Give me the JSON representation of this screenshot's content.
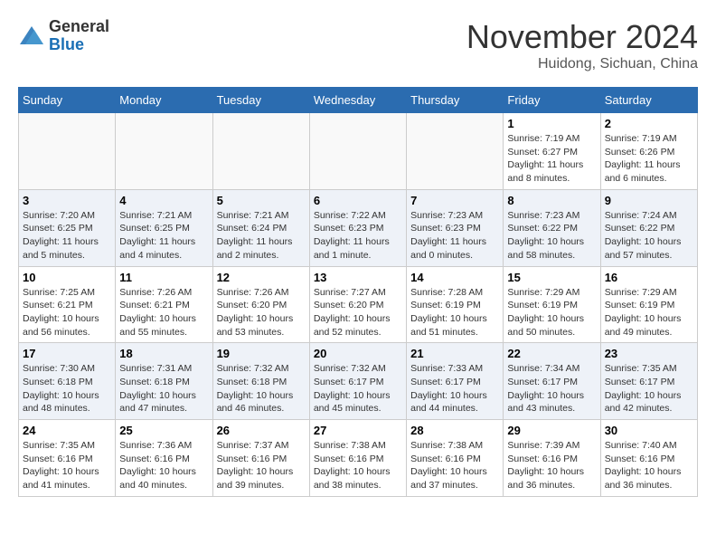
{
  "logo": {
    "general": "General",
    "blue": "Blue"
  },
  "header": {
    "month": "November 2024",
    "location": "Huidong, Sichuan, China"
  },
  "weekdays": [
    "Sunday",
    "Monday",
    "Tuesday",
    "Wednesday",
    "Thursday",
    "Friday",
    "Saturday"
  ],
  "weeks": [
    [
      {
        "day": "",
        "info": ""
      },
      {
        "day": "",
        "info": ""
      },
      {
        "day": "",
        "info": ""
      },
      {
        "day": "",
        "info": ""
      },
      {
        "day": "",
        "info": ""
      },
      {
        "day": "1",
        "info": "Sunrise: 7:19 AM\nSunset: 6:27 PM\nDaylight: 11 hours and 8 minutes."
      },
      {
        "day": "2",
        "info": "Sunrise: 7:19 AM\nSunset: 6:26 PM\nDaylight: 11 hours and 6 minutes."
      }
    ],
    [
      {
        "day": "3",
        "info": "Sunrise: 7:20 AM\nSunset: 6:25 PM\nDaylight: 11 hours and 5 minutes."
      },
      {
        "day": "4",
        "info": "Sunrise: 7:21 AM\nSunset: 6:25 PM\nDaylight: 11 hours and 4 minutes."
      },
      {
        "day": "5",
        "info": "Sunrise: 7:21 AM\nSunset: 6:24 PM\nDaylight: 11 hours and 2 minutes."
      },
      {
        "day": "6",
        "info": "Sunrise: 7:22 AM\nSunset: 6:23 PM\nDaylight: 11 hours and 1 minute."
      },
      {
        "day": "7",
        "info": "Sunrise: 7:23 AM\nSunset: 6:23 PM\nDaylight: 11 hours and 0 minutes."
      },
      {
        "day": "8",
        "info": "Sunrise: 7:23 AM\nSunset: 6:22 PM\nDaylight: 10 hours and 58 minutes."
      },
      {
        "day": "9",
        "info": "Sunrise: 7:24 AM\nSunset: 6:22 PM\nDaylight: 10 hours and 57 minutes."
      }
    ],
    [
      {
        "day": "10",
        "info": "Sunrise: 7:25 AM\nSunset: 6:21 PM\nDaylight: 10 hours and 56 minutes."
      },
      {
        "day": "11",
        "info": "Sunrise: 7:26 AM\nSunset: 6:21 PM\nDaylight: 10 hours and 55 minutes."
      },
      {
        "day": "12",
        "info": "Sunrise: 7:26 AM\nSunset: 6:20 PM\nDaylight: 10 hours and 53 minutes."
      },
      {
        "day": "13",
        "info": "Sunrise: 7:27 AM\nSunset: 6:20 PM\nDaylight: 10 hours and 52 minutes."
      },
      {
        "day": "14",
        "info": "Sunrise: 7:28 AM\nSunset: 6:19 PM\nDaylight: 10 hours and 51 minutes."
      },
      {
        "day": "15",
        "info": "Sunrise: 7:29 AM\nSunset: 6:19 PM\nDaylight: 10 hours and 50 minutes."
      },
      {
        "day": "16",
        "info": "Sunrise: 7:29 AM\nSunset: 6:19 PM\nDaylight: 10 hours and 49 minutes."
      }
    ],
    [
      {
        "day": "17",
        "info": "Sunrise: 7:30 AM\nSunset: 6:18 PM\nDaylight: 10 hours and 48 minutes."
      },
      {
        "day": "18",
        "info": "Sunrise: 7:31 AM\nSunset: 6:18 PM\nDaylight: 10 hours and 47 minutes."
      },
      {
        "day": "19",
        "info": "Sunrise: 7:32 AM\nSunset: 6:18 PM\nDaylight: 10 hours and 46 minutes."
      },
      {
        "day": "20",
        "info": "Sunrise: 7:32 AM\nSunset: 6:17 PM\nDaylight: 10 hours and 45 minutes."
      },
      {
        "day": "21",
        "info": "Sunrise: 7:33 AM\nSunset: 6:17 PM\nDaylight: 10 hours and 44 minutes."
      },
      {
        "day": "22",
        "info": "Sunrise: 7:34 AM\nSunset: 6:17 PM\nDaylight: 10 hours and 43 minutes."
      },
      {
        "day": "23",
        "info": "Sunrise: 7:35 AM\nSunset: 6:17 PM\nDaylight: 10 hours and 42 minutes."
      }
    ],
    [
      {
        "day": "24",
        "info": "Sunrise: 7:35 AM\nSunset: 6:16 PM\nDaylight: 10 hours and 41 minutes."
      },
      {
        "day": "25",
        "info": "Sunrise: 7:36 AM\nSunset: 6:16 PM\nDaylight: 10 hours and 40 minutes."
      },
      {
        "day": "26",
        "info": "Sunrise: 7:37 AM\nSunset: 6:16 PM\nDaylight: 10 hours and 39 minutes."
      },
      {
        "day": "27",
        "info": "Sunrise: 7:38 AM\nSunset: 6:16 PM\nDaylight: 10 hours and 38 minutes."
      },
      {
        "day": "28",
        "info": "Sunrise: 7:38 AM\nSunset: 6:16 PM\nDaylight: 10 hours and 37 minutes."
      },
      {
        "day": "29",
        "info": "Sunrise: 7:39 AM\nSunset: 6:16 PM\nDaylight: 10 hours and 36 minutes."
      },
      {
        "day": "30",
        "info": "Sunrise: 7:40 AM\nSunset: 6:16 PM\nDaylight: 10 hours and 36 minutes."
      }
    ]
  ]
}
